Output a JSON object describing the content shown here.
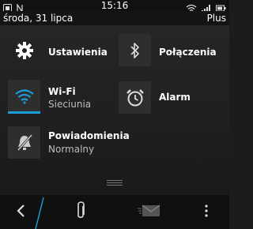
{
  "status_bar": {
    "time": "15:16",
    "left_icons": [
      "notification-icon",
      "n-icon"
    ],
    "right_icons": [
      "wifi-icon",
      "cellular-signal-icon",
      "battery-icon"
    ]
  },
  "date_bar": {
    "date": "środa, 31 lipca",
    "profile": "Plus"
  },
  "tiles": {
    "settings": {
      "label": "Ustawienia",
      "icon": "gear-icon"
    },
    "connections": {
      "label": "Połączenia",
      "icon": "bluetooth-icon"
    },
    "wifi": {
      "label": "Wi-Fi",
      "sub": "Sieciunia",
      "icon": "wifi-icon",
      "active": true
    },
    "alarm": {
      "label": "Alarm",
      "icon": "alarm-clock-icon"
    },
    "notifications": {
      "label": "Powiadomienia",
      "sub": "Normalny",
      "icon": "bell-muted-icon"
    }
  },
  "bottom_bar": {
    "buttons": [
      "back-icon",
      "attach-icon",
      "mail-icon",
      "more-icon"
    ]
  },
  "colors": {
    "accent": "#1b9ed7",
    "background": "#1c1c1c",
    "tile_icon_bg": "#2e2e2e"
  }
}
